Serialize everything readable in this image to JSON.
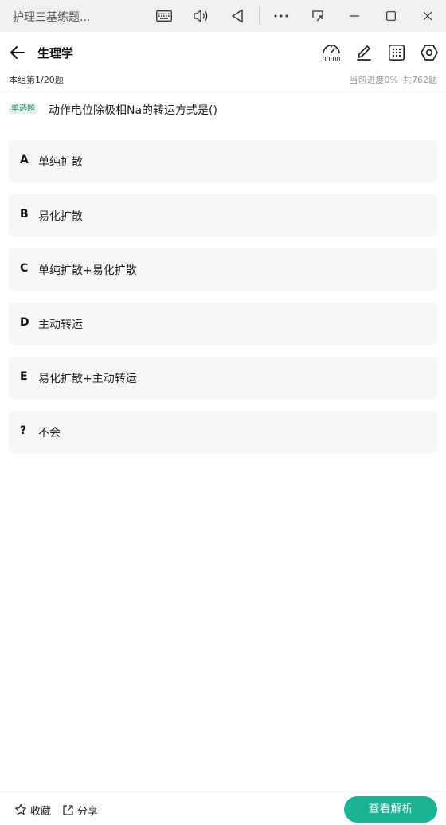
{
  "window": {
    "title": "护理三基练题..."
  },
  "header": {
    "subject": "生理学",
    "timer": "00:00"
  },
  "progress": {
    "group_label": "本组第1/20题",
    "current_progress": "当前进度0%",
    "total": "共762题"
  },
  "question": {
    "type_label": "单选题",
    "text": "动作电位除极相Na的转运方式是()"
  },
  "options": [
    {
      "letter": "A",
      "text": "单纯扩散"
    },
    {
      "letter": "B",
      "text": "易化扩散"
    },
    {
      "letter": "C",
      "text": "单纯扩散+易化扩散"
    },
    {
      "letter": "D",
      "text": "主动转运"
    },
    {
      "letter": "E",
      "text": "易化扩散+主动转运"
    },
    {
      "letter": "?",
      "text": "不会"
    }
  ],
  "bottom": {
    "favorite_label": "收藏",
    "share_label": "分享",
    "analysis_label": "查看解析"
  },
  "colors": {
    "accent": "#1ab394",
    "option_bg": "#f7f7f7",
    "titlebar_bg": "#f0f0f0"
  },
  "icons": {
    "titlebar": [
      "keyboard-icon",
      "volume-icon",
      "back-triangle-icon",
      "more-icon",
      "screen-icon",
      "minimize-icon",
      "maximize-icon",
      "close-icon"
    ],
    "header": [
      "back-arrow-icon",
      "timer-icon",
      "pencil-icon",
      "grid-icon",
      "settings-hex-icon"
    ],
    "bottom": [
      "star-icon",
      "share-icon"
    ]
  }
}
